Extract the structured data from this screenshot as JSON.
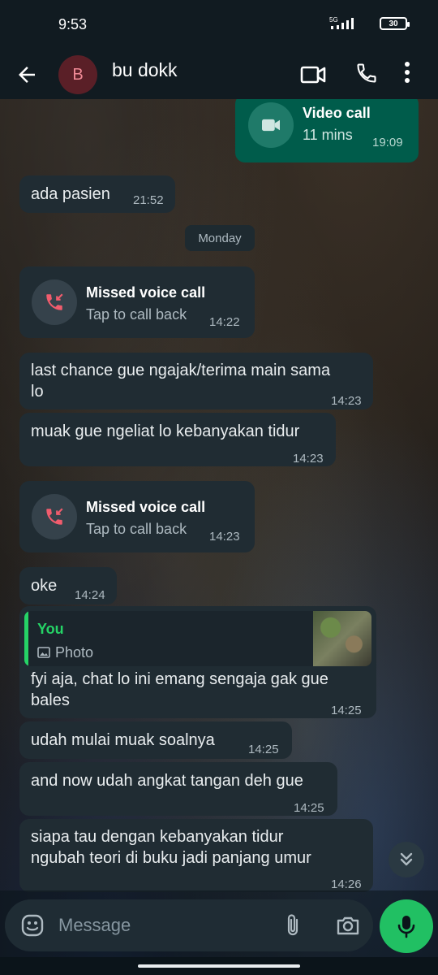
{
  "status_bar": {
    "time": "9:53",
    "network": "5G",
    "battery": "30"
  },
  "header": {
    "avatar_initial": "B",
    "contact_name": "bu dokk"
  },
  "messages": [
    {
      "type": "call",
      "direction": "out",
      "title": "Video call",
      "subtitle": "11 mins",
      "time": "19:09"
    },
    {
      "type": "text",
      "direction": "in",
      "text": "ada pasien",
      "time": "21:52"
    },
    {
      "type": "date",
      "text": "Monday"
    },
    {
      "type": "call",
      "direction": "in",
      "title": "Missed voice call",
      "subtitle": "Tap to call back",
      "time": "14:22"
    },
    {
      "type": "text",
      "direction": "in",
      "lines": [
        "last chance gue ngajak/terima main sama",
        "lo"
      ],
      "time": "14:23"
    },
    {
      "type": "text",
      "direction": "in",
      "text": "muak gue ngeliat lo kebanyakan tidur",
      "time": "14:23"
    },
    {
      "type": "call",
      "direction": "in",
      "title": "Missed voice call",
      "subtitle": "Tap to call back",
      "time": "14:23"
    },
    {
      "type": "text",
      "direction": "in",
      "text": "oke",
      "time": "14:24"
    },
    {
      "type": "reply",
      "direction": "in",
      "quote_author": "You",
      "quote_type": "Photo",
      "lines": [
        "fyi aja, chat lo ini emang sengaja gak gue",
        "bales"
      ],
      "time": "14:25"
    },
    {
      "type": "text",
      "direction": "in",
      "text": "udah mulai muak soalnya",
      "time": "14:25"
    },
    {
      "type": "text",
      "direction": "in",
      "text": "and now udah angkat tangan deh gue",
      "time": "14:25"
    },
    {
      "type": "text",
      "direction": "in",
      "lines": [
        "siapa tau dengan kebanyakan tidur",
        "ngubah teori di buku jadi panjang umur"
      ],
      "time": "14:26"
    }
  ],
  "composer": {
    "placeholder": "Message"
  },
  "icons": {
    "back": "arrow-left-icon",
    "video": "video-camera-icon",
    "phone": "phone-icon",
    "more": "more-vertical-icon",
    "missed": "missed-call-icon",
    "emoji": "emoji-icon",
    "attach": "paperclip-icon",
    "camera": "camera-icon",
    "mic": "microphone-icon",
    "scroll": "double-chevron-down-icon"
  },
  "colors": {
    "incoming_bubble": "#202c33",
    "outgoing_bubble": "#005c4b",
    "accent": "#25d366",
    "missed_red": "#f15c6d"
  }
}
